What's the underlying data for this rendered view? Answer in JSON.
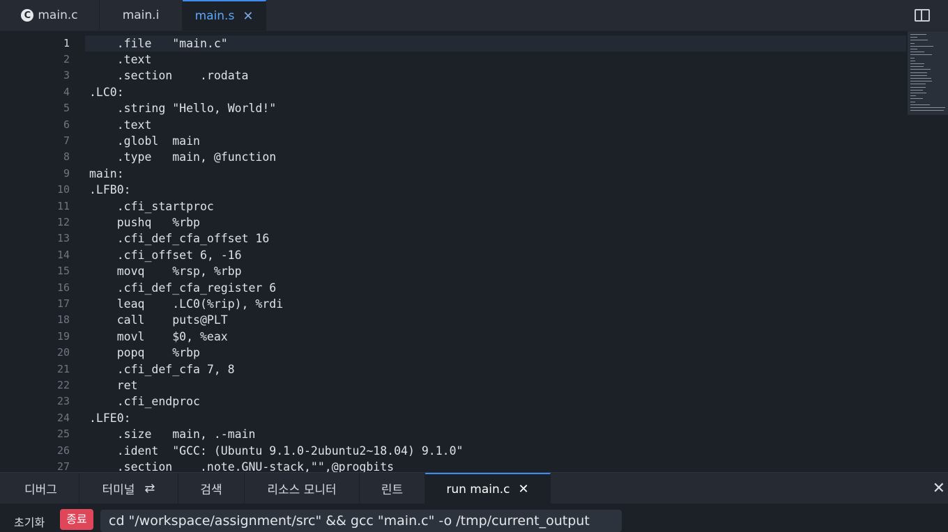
{
  "editor_tabs": [
    {
      "label": "main.c",
      "icon": "c-language-icon"
    },
    {
      "label": "main.i"
    },
    {
      "label": "main.s",
      "active": true
    }
  ],
  "code_lines": [
    {
      "n": "1",
      "text": "    .file\t\"main.c\""
    },
    {
      "n": "2",
      "text": "    .text"
    },
    {
      "n": "3",
      "text": "    .section\t.rodata"
    },
    {
      "n": "4",
      "text": ".LC0:"
    },
    {
      "n": "5",
      "text": "    .string\t\"Hello, World!\""
    },
    {
      "n": "6",
      "text": "    .text"
    },
    {
      "n": "7",
      "text": "    .globl\tmain"
    },
    {
      "n": "8",
      "text": "    .type\tmain, @function"
    },
    {
      "n": "9",
      "text": "main:"
    },
    {
      "n": "10",
      "text": ".LFB0:"
    },
    {
      "n": "11",
      "text": "    .cfi_startproc"
    },
    {
      "n": "12",
      "text": "    pushq\t%rbp"
    },
    {
      "n": "13",
      "text": "    .cfi_def_cfa_offset 16"
    },
    {
      "n": "14",
      "text": "    .cfi_offset 6, -16"
    },
    {
      "n": "15",
      "text": "    movq\t%rsp, %rbp"
    },
    {
      "n": "16",
      "text": "    .cfi_def_cfa_register 6"
    },
    {
      "n": "17",
      "text": "    leaq\t.LC0(%rip), %rdi"
    },
    {
      "n": "18",
      "text": "    call\tputs@PLT"
    },
    {
      "n": "19",
      "text": "    movl\t$0, %eax"
    },
    {
      "n": "20",
      "text": "    popq\t%rbp"
    },
    {
      "n": "21",
      "text": "    .cfi_def_cfa 7, 8"
    },
    {
      "n": "22",
      "text": "    ret"
    },
    {
      "n": "23",
      "text": "    .cfi_endproc"
    },
    {
      "n": "24",
      "text": ".LFE0:"
    },
    {
      "n": "25",
      "text": "    .size\tmain, .-main"
    },
    {
      "n": "26",
      "text": "    .ident\t\"GCC: (Ubuntu 9.1.0-2ubuntu2~18.04) 9.1.0\""
    },
    {
      "n": "27",
      "text": "    .section\t.note.GNU-stack,\"\",@progbits"
    }
  ],
  "panel_tabs": [
    {
      "label": "디버그"
    },
    {
      "label": "터미널",
      "icon": "refresh-icon"
    },
    {
      "label": "검색"
    },
    {
      "label": "리소스 모니터"
    },
    {
      "label": "린트"
    },
    {
      "label": "run main.c",
      "active": true
    }
  ],
  "panel": {
    "reset_label": "초기화",
    "stop_label": "종료",
    "command": "cd \"/workspace/assignment/src\" && gcc \"main.c\" -o /tmp/current_output"
  },
  "colors": {
    "accent": "#3f8cf0",
    "stop": "#e0465a",
    "background": "#1c2128"
  }
}
